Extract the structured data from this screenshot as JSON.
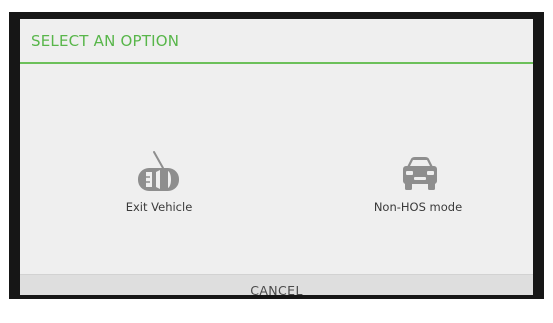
{
  "dialog": {
    "title": "SELECT AN OPTION",
    "options": [
      {
        "label": "Exit Vehicle",
        "icon": "car-door-open-icon"
      },
      {
        "label": "Non-HOS mode",
        "icon": "car-front-icon"
      }
    ],
    "cancel_label": "CANCEL"
  },
  "colors": {
    "accent": "#58b64a",
    "icon": "#8e8e8e",
    "dialog_bg": "#efefef",
    "footer_bg": "#dedede",
    "frame": "#161616"
  }
}
